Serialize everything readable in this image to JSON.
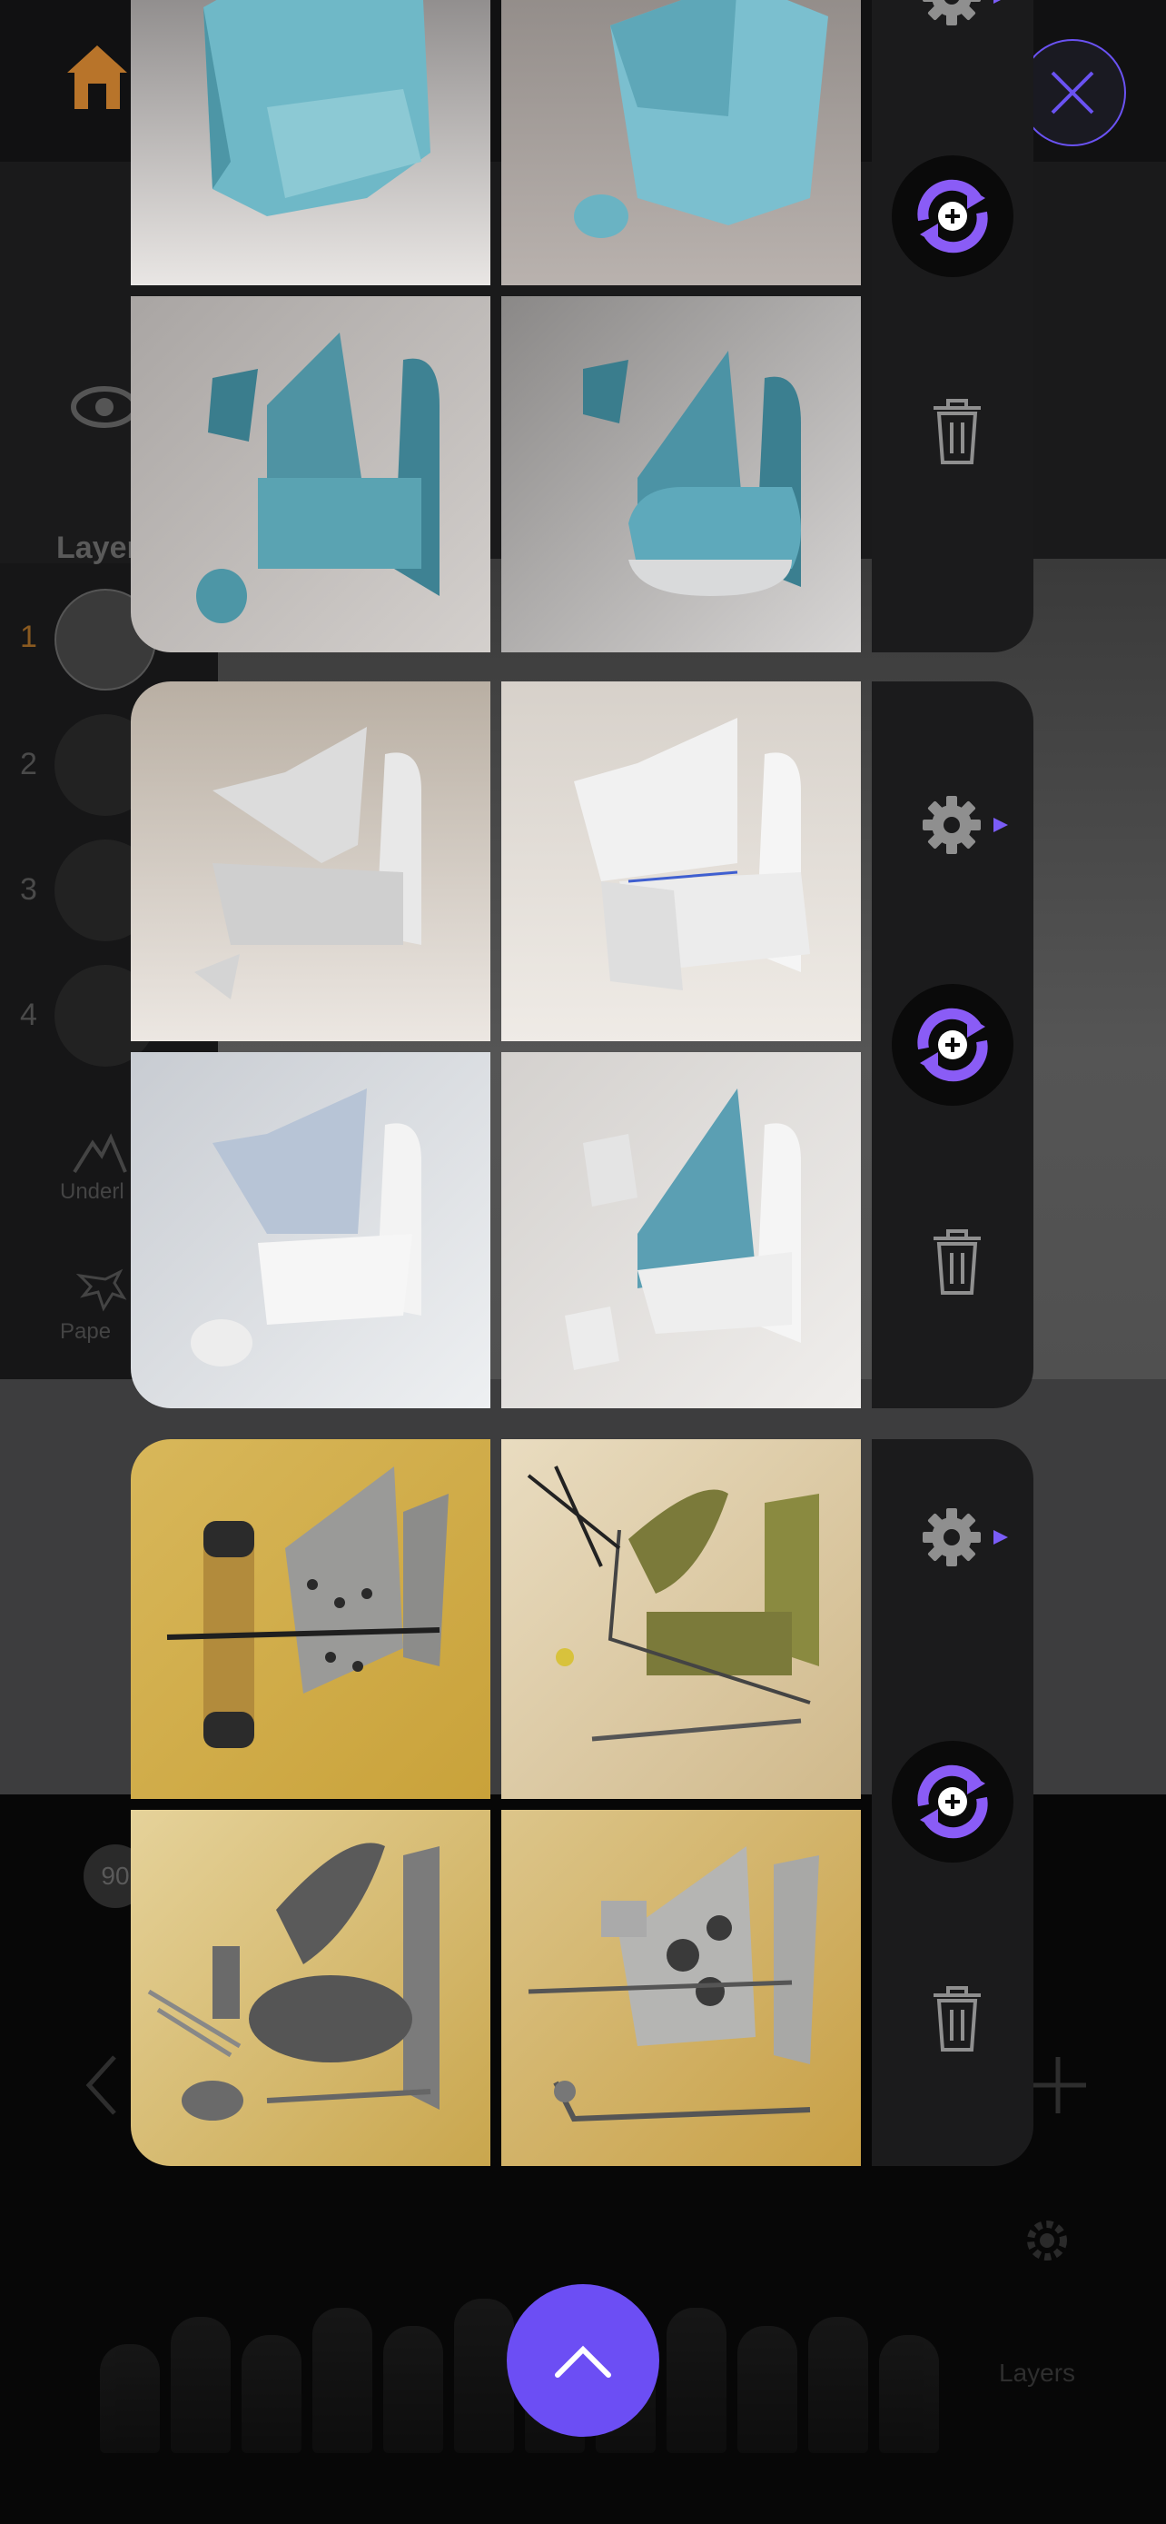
{
  "background_app": {
    "layers_title": "Layer",
    "layer_numbers": [
      "1",
      "2",
      "3",
      "4"
    ],
    "tools": [
      {
        "label": "Underl",
        "icon": "mountain-icon"
      },
      {
        "label": "Pape",
        "icon": "texture-icon"
      }
    ],
    "chip_text": "90",
    "side_label": "Layers"
  },
  "groups": [
    {
      "name": "Blue chair renders",
      "tiles": [
        "blue-chair-render-1",
        "blue-chair-render-2",
        "blue-chair-render-3",
        "blue-chair-render-4"
      ]
    },
    {
      "name": "White chair renders",
      "tiles": [
        "white-chair-render-1",
        "white-chair-render-2",
        "white-chair-render-3",
        "white-chair-render-4"
      ]
    },
    {
      "name": "Metal parts renders",
      "tiles": [
        "metal-parts-render-1",
        "metal-parts-render-2",
        "metal-parts-render-3",
        "metal-parts-render-4"
      ]
    }
  ],
  "colors": {
    "accent": "#6c4ef4",
    "regen_accent": "#8a5cf6",
    "home": "#b8742a",
    "strip": "#1b1b1c"
  },
  "icons": {
    "close": "close-icon",
    "home": "home-icon",
    "settings": "gear-icon",
    "regenerate": "regenerate-icon",
    "delete": "trash-icon",
    "expand": "chevron-up-icon"
  }
}
